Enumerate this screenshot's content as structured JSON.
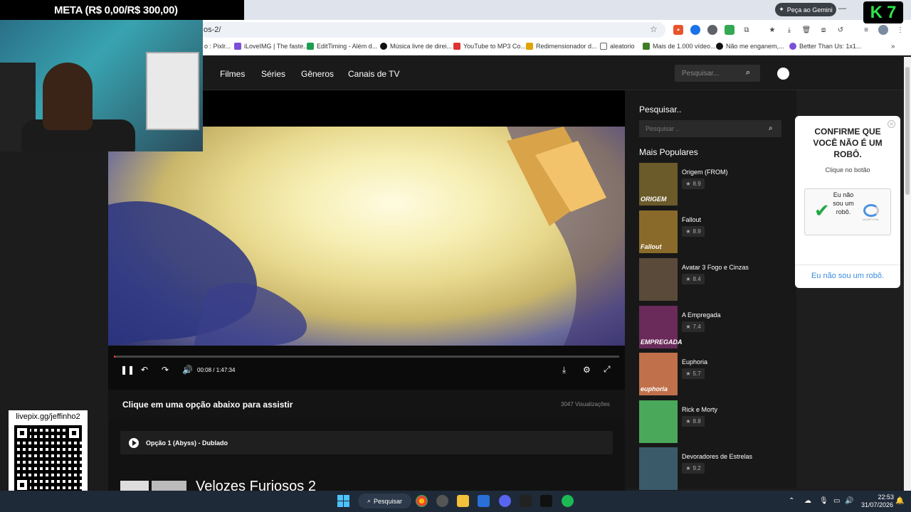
{
  "stream_overlay": {
    "goal_text": "META (R$ 0,00/R$ 300,00)",
    "logo_k": "K",
    "logo_7": "7",
    "qr_label": "livepix.gg/jeffinho2"
  },
  "browser": {
    "gemini_label": "Peça ao Gemini",
    "url_fragment": "os-2/",
    "bookmarks": [
      {
        "label": "o : Pixlr...",
        "color": "#d33"
      },
      {
        "label": "iLoveIMG | The faste...",
        "color": "#7b4fd6"
      },
      {
        "label": "EditTiming - Além d...",
        "color": "#1a9e4f"
      },
      {
        "label": "Música livre de direi...",
        "color": "#111"
      },
      {
        "label": "YouTube to MP3 Co...",
        "color": "#d33"
      },
      {
        "label": "Redimensionador d...",
        "color": "#e0a400"
      },
      {
        "label": "aleatorio",
        "color": "#666"
      },
      {
        "label": "Mais de 1.000 vídeo...",
        "color": "#3e7d25"
      },
      {
        "label": "Não me enganem,...",
        "color": "#111"
      },
      {
        "label": "Better Than Us: 1x1...",
        "color": "#7b4fd6"
      }
    ]
  },
  "site": {
    "nav": [
      "Filmes",
      "Séries",
      "Gêneros",
      "Canais de TV"
    ],
    "search_placeholder": "Pesquisar..."
  },
  "player": {
    "time_current": "00:08",
    "time_separator": "/",
    "time_total": "1:47:34",
    "progress": 0.0012
  },
  "watch": {
    "title": "Clique em uma opção abaixo para assistir",
    "views": "3047 Visualizações",
    "option_label": "Opção 1 (Abyss) - Dublado",
    "movie_title": "Velozes Furiosos 2"
  },
  "sidebar": {
    "search_label": "Pesquisar..",
    "search_placeholder": "Pesquisar ..",
    "popular_title": "Mais Populares",
    "items": [
      {
        "name": "Origem (FROM)",
        "rating": "8.9",
        "thumb_text": "ORIGEM",
        "color": "#6b5a2a"
      },
      {
        "name": "Fallout",
        "rating": "8.9",
        "thumb_text": "Fallout",
        "color": "#8a6a2a"
      },
      {
        "name": "Avatar 3 Fogo e Cinzas",
        "rating": "8.4",
        "thumb_text": "",
        "color": "#5a4a3a"
      },
      {
        "name": "A Empregada",
        "rating": "7.4",
        "thumb_text": "EMPREGADA",
        "color": "#6a2a5a"
      },
      {
        "name": "Euphoria",
        "rating": "5.7",
        "thumb_text": "euphoria",
        "color": "#c0704a"
      },
      {
        "name": "Rick e Morty",
        "rating": "8.8",
        "thumb_text": "",
        "color": "#4aa85a"
      },
      {
        "name": "Devoradores de Estrelas",
        "rating": "9.2",
        "thumb_text": "",
        "color": "#3a5a6a"
      }
    ]
  },
  "captcha": {
    "title": "CONFIRME QUE VOCÊ NÃO É UM ROBÔ.",
    "subtitle": "Clique no botão",
    "checkbox_label": "Eu não sou um robô.",
    "brand": "reCAPTCHA",
    "link": "Eu não sou um robô."
  },
  "taskbar": {
    "search_label": "Pesquisar",
    "time": "22:53",
    "date": "31/07/2026"
  }
}
